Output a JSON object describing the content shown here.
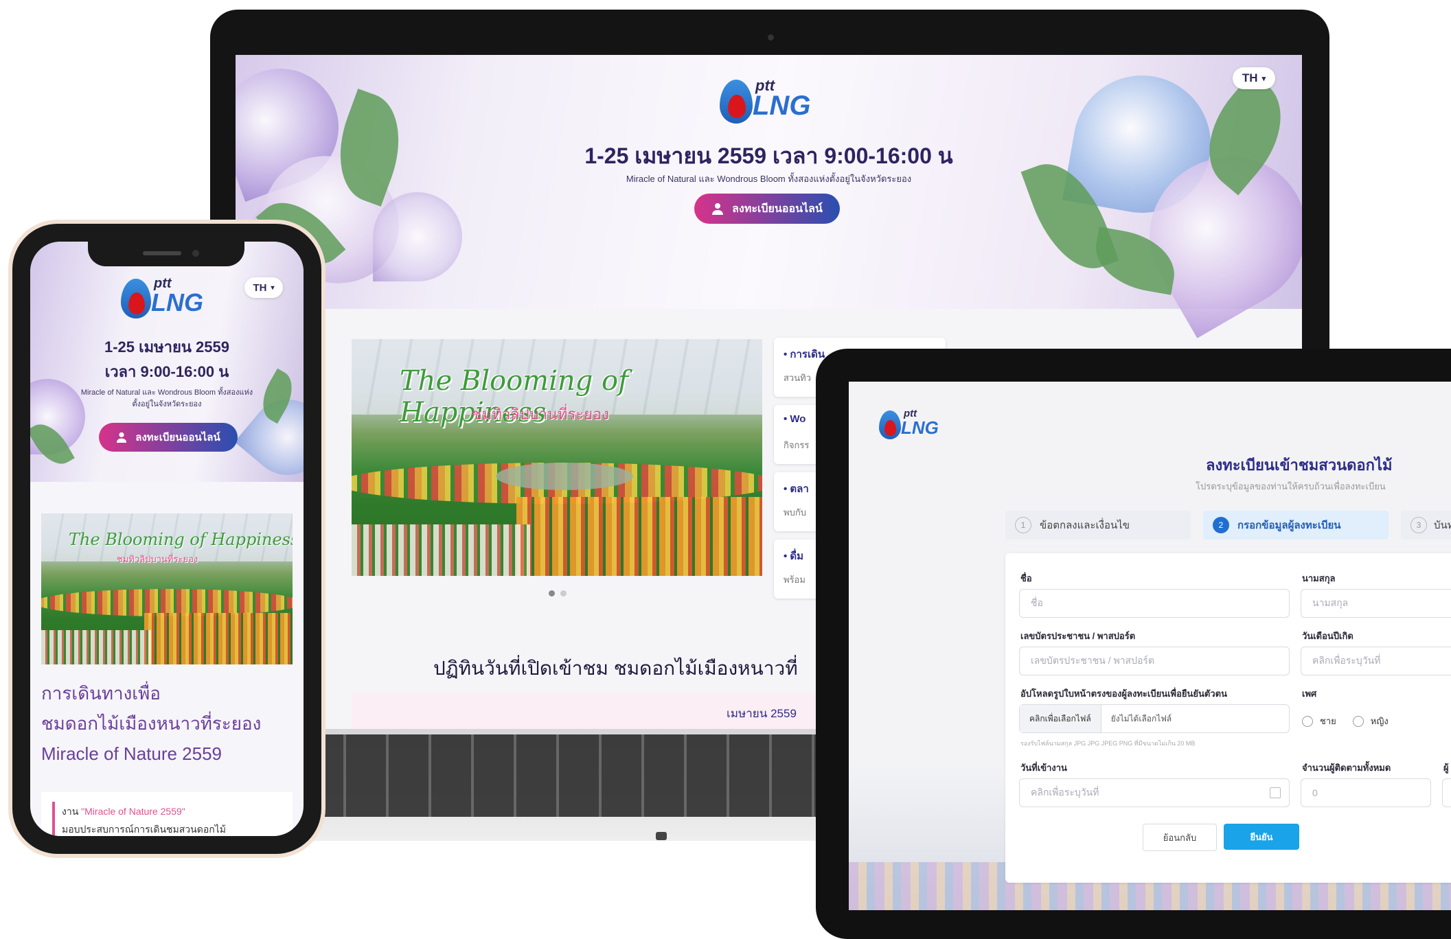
{
  "brand": {
    "small": "ptt",
    "big": "LNG",
    "drop_color": "#d9161c",
    "blue": "#1f6fd0"
  },
  "laptop": {
    "lang": "TH",
    "hero_title": "1-25 เมษายน 2559 เวลา 9:00-16:00 น",
    "hero_subtitle": "Miracle of Natural และ Wondrous Bloom ทั้งสองแห่งตั้งอยู่ในจังหวัดระยอง",
    "register_label": "ลงทะเบียนออนไลน์",
    "banner_script": "The Blooming of Happiness",
    "banner_sub": "ชมทิวลิปบานที่ระยอง",
    "side_cards": [
      {
        "title": "การเดิน",
        "text": "สวนทิว"
      },
      {
        "title": "Wo",
        "text": "กิจกรร"
      },
      {
        "title": "ตลา",
        "text": "พบกับ"
      },
      {
        "title": "ดื่ม",
        "text": "พร้อม"
      }
    ],
    "section_title": "ปฏิทินวันที่เปิดเข้าชม ชมดอกไม้เมืองหนาวที่",
    "calendar_month": "เมษายน 2559"
  },
  "tablet": {
    "form_title": "ลงทะเบียนเข้าชมสวนดอกไม้",
    "form_subtitle": "โปรดระบุข้อมูลของท่านให้ครบถ้วนเพื่อลงทะเบียน",
    "steps": [
      {
        "num": "1",
        "label": "ข้อตกลงและเงื่อนไข"
      },
      {
        "num": "2",
        "label": "กรอกข้อมูลผู้ลงทะเบียน"
      },
      {
        "num": "3",
        "label": "บันท"
      }
    ],
    "fields": {
      "first_name_label": "ชื่อ",
      "first_name_placeholder": "ชื่อ",
      "last_name_label": "นามสกุล",
      "last_name_placeholder": "นามสกุล",
      "id_label": "เลขบัตรประชาชน / พาสปอร์ต",
      "id_placeholder": "เลขบัตรประชาชน / พาสปอร์ต",
      "dob_label": "วันเดือนปีเกิด",
      "dob_placeholder": "คลิกเพื่อระบุวันที่",
      "upload_label": "อัปโหลดรูปใบหน้าตรงของผู้ลงทะเบียนเพื่อยืนยันตัวตน",
      "upload_button": "คลิกเพื่อเลือกไฟล์",
      "upload_status": "ยังไม่ได้เลือกไฟล์",
      "upload_hint": "รองรับไฟล์นามสกุล JPG JPG JPEG PNG ที่มีขนาดไม่เกิน 20 MB",
      "gender_label": "เพศ",
      "gender_male": "ชาย",
      "gender_female": "หญิง",
      "visit_label": "วันที่เข้างาน",
      "visit_placeholder": "คลิกเพื่อระบุวันที่",
      "companions_label": "จำนวนผู้ติดตามทั้งหมด",
      "companions_value": "0",
      "extra_label": "ผู้"
    },
    "back_button": "ย้อนกลับ",
    "confirm_button": "ยืนยัน"
  },
  "phone": {
    "lang": "TH",
    "hero_line1": "1-25 เมษายน 2559",
    "hero_line2": "เวลา 9:00-16:00 น",
    "hero_sub": "Miracle of Natural และ Wondrous Bloom ทั้งสองแห่งตั้งอยู่ในจังหวัดระยอง",
    "register_label": "ลงทะเบียนออนไลน์",
    "banner_script": "The Blooming of Happiness",
    "banner_sub": "ชมทิวลิปบานที่ระยอง",
    "article_title_1": "การเดินทางเพื่อ",
    "article_title_2": "ชมดอกไม้เมืองหนาวที่ระยอง",
    "article_title_3": "Miracle of Nature 2559",
    "quote_prefix": "งาน ",
    "quote_highlight": "\"Miracle of Nature 2559\"",
    "quote_line2": "มอบประสบการณ์การเดินชมสวนดอกไม้"
  }
}
